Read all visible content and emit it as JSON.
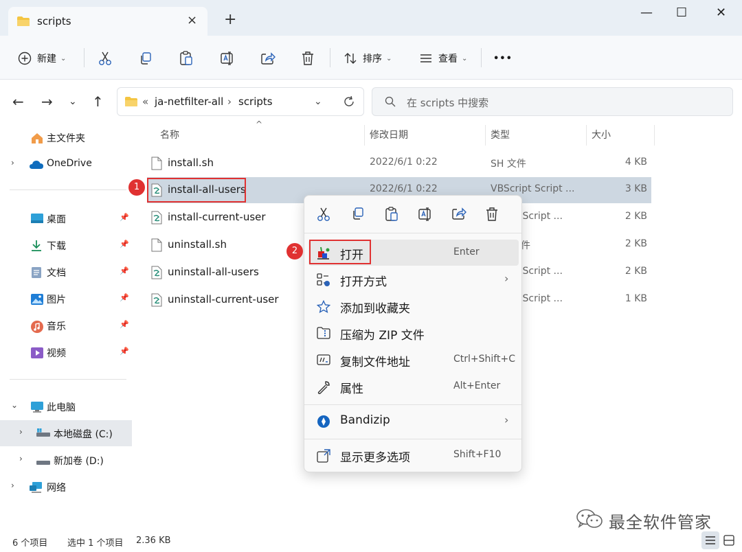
{
  "window": {
    "tab_title": "scripts",
    "new_tab_symbol": "+",
    "tab_close_symbol": "×",
    "minimize_symbol": "—",
    "maximize_symbol": "☐",
    "close_symbol": "✕"
  },
  "toolbar": {
    "new_label": "新建",
    "sort_label": "排序",
    "view_label": "查看",
    "more_symbol": "•••",
    "icons": [
      "cut-icon",
      "copy-icon",
      "paste-icon",
      "rename-icon",
      "share-icon",
      "delete-icon"
    ]
  },
  "address": {
    "overflow": "«",
    "crumbs": [
      "ja-netfilter-all",
      "scripts"
    ],
    "separator": "›",
    "search_placeholder": "在 scripts 中搜索"
  },
  "sidebar": {
    "home": "主文件夹",
    "onedrive": "OneDrive",
    "quick_access": [
      "桌面",
      "下载",
      "文档",
      "图片",
      "音乐",
      "视频"
    ],
    "this_pc": "此电脑",
    "drive_c": "本地磁盘 (C:)",
    "drive_d": "新加卷 (D:)",
    "network": "网络"
  },
  "columns": {
    "name": "名称",
    "date": "修改日期",
    "type": "类型",
    "size": "大小"
  },
  "files": [
    {
      "name": "install.sh",
      "date": "2022/6/1 0:22",
      "type": "SH 文件",
      "size": "4 KB"
    },
    {
      "name": "install-all-users",
      "date": "2022/6/1 0:22",
      "type": "VBScript Script ...",
      "size": "3 KB"
    },
    {
      "name": "install-current-user",
      "date": "",
      "type": "ot Script ...",
      "size": "2 KB"
    },
    {
      "name": "uninstall.sh",
      "date": "",
      "type": "件",
      "size": "2 KB"
    },
    {
      "name": "uninstall-all-users",
      "date": "",
      "type": "ot Script ...",
      "size": "2 KB"
    },
    {
      "name": "uninstall-current-user",
      "date": "",
      "type": "ot Script ...",
      "size": "1 KB"
    }
  ],
  "context_menu": {
    "open": {
      "label": "打开",
      "shortcut": "Enter"
    },
    "open_with": {
      "label": "打开方式"
    },
    "add_favorites": {
      "label": "添加到收藏夹"
    },
    "compress_zip": {
      "label": "压缩为 ZIP 文件"
    },
    "copy_path": {
      "label": "复制文件地址",
      "shortcut": "Ctrl+Shift+C"
    },
    "properties": {
      "label": "属性",
      "shortcut": "Alt+Enter"
    },
    "bandizip": {
      "label": "Bandizip"
    },
    "more_options": {
      "label": "显示更多选项",
      "shortcut": "Shift+F10"
    },
    "submenu_arrow": "›"
  },
  "annotations": {
    "step1": "1",
    "step2": "2"
  },
  "status": {
    "item_count": "6 个项目",
    "selection": "选中 1 个项目",
    "selection_size": "2.36 KB"
  },
  "watermark": {
    "text": "最全软件管家"
  },
  "colors": {
    "accent": "#0067c0",
    "highlight_red": "#e03131",
    "selection_bg": "#cdd7e1",
    "folder_yellow": "#f4c542"
  }
}
